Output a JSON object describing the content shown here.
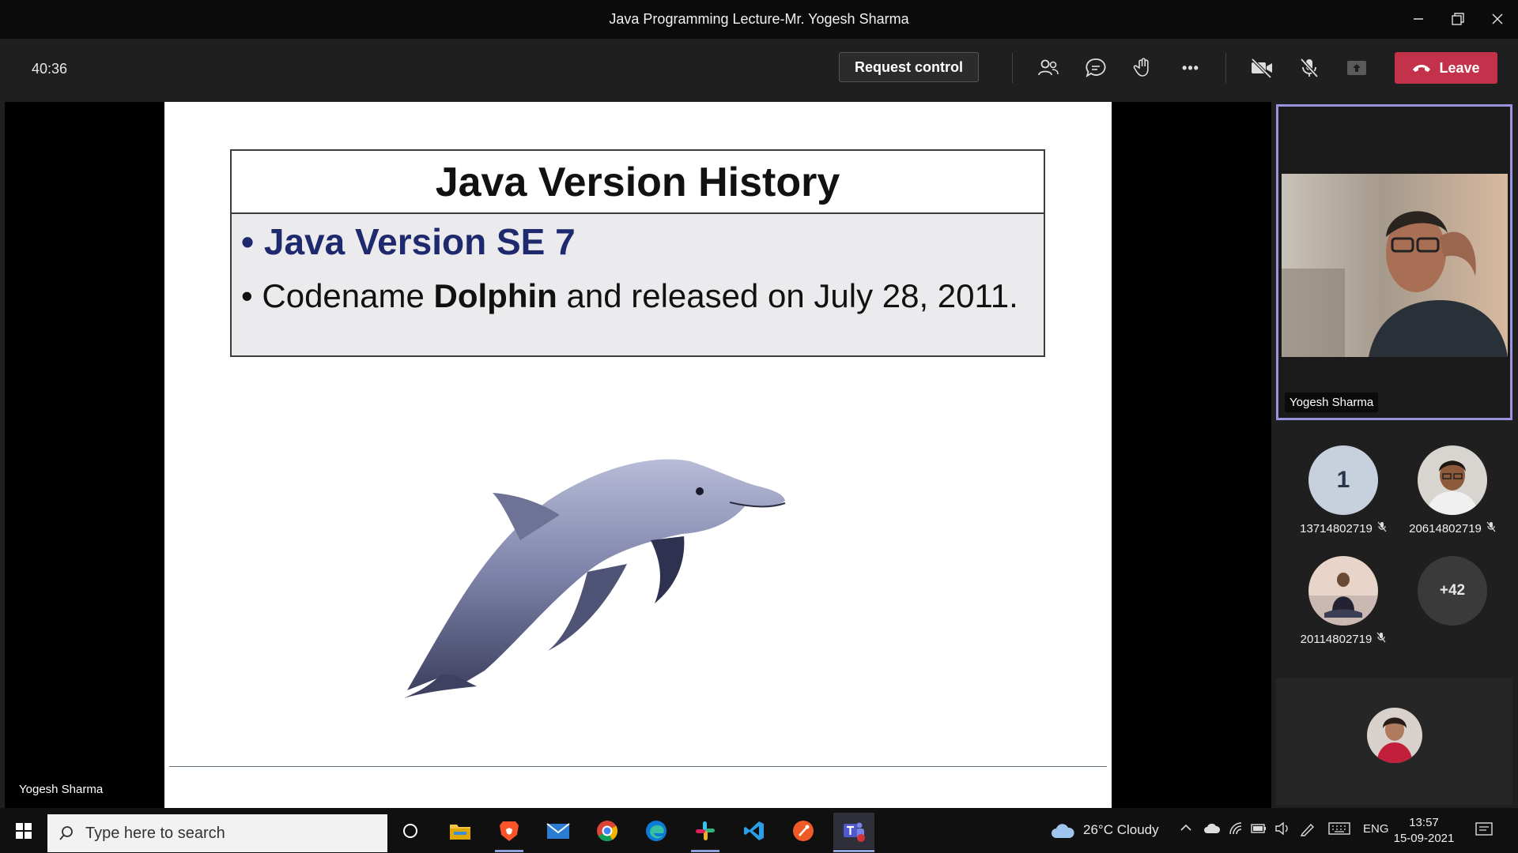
{
  "window": {
    "title": "Java Programming Lecture-Mr. Yogesh Sharma",
    "controls": [
      "minimize-icon",
      "restore-icon",
      "close-icon"
    ]
  },
  "meeting_bar": {
    "timer": "40:36",
    "request_control": "Request control",
    "more_label": "•••",
    "leave": "Leave",
    "leave_color": "#c4314b",
    "icons": [
      "people-icon",
      "chat-icon",
      "raise-hand-icon",
      "more-icon",
      "camera-off-icon",
      "mic-off-icon",
      "share-tray-icon",
      "phone-hangup-icon"
    ]
  },
  "slide": {
    "title": "Java Version History",
    "bullet1": "• Java Version SE 7",
    "bullet2_pre": "• Codename ",
    "bullet2_bold": "Dolphin",
    "bullet2_post": " and released on July 28, 2011.",
    "accent_color": "#1f2a6e"
  },
  "presenter_label": "Yogesh Sharma",
  "side_panel": {
    "pinned_name": "Yogesh Sharma",
    "pinned_border_color": "#9a93e0",
    "participants": [
      {
        "avatar_text": "1",
        "name": "13714802719",
        "muted": true
      },
      {
        "avatar_text": "",
        "name": "20614802719",
        "muted": true
      },
      {
        "avatar_text": "",
        "name": "20114802719",
        "muted": true
      },
      {
        "avatar_text": "+42",
        "name": "",
        "muted": false
      }
    ]
  },
  "taskbar": {
    "search_placeholder": "Type here to search",
    "weather": "26°C  Cloudy",
    "language": "ENG",
    "time": "13:57",
    "date": "15-09-2021",
    "apps": [
      "task-view-icon",
      "file-explorer-icon",
      "brave-icon",
      "mail-icon",
      "chrome-icon",
      "edge-icon",
      "slack-icon",
      "vscode-icon",
      "postman-icon",
      "teams-icon"
    ]
  }
}
